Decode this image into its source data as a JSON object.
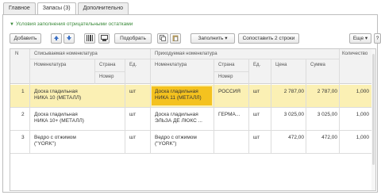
{
  "tabs": [
    {
      "label": "Главное"
    },
    {
      "label": "Запасы (3)"
    },
    {
      "label": "Дополнительно"
    }
  ],
  "condition_text": "Условия заполнения отрицательными остатками",
  "toolbar": {
    "add": "Добавить",
    "pick": "Подобрать",
    "fill": "Заполнить",
    "match": "Сопоставить 2 строки",
    "more": "Еще",
    "help": "?"
  },
  "table": {
    "group_written_off": "Списываемая номенклатура",
    "group_incoming": "Приходуемая номенклатура",
    "headers": {
      "n": "N",
      "nom1": "Номенклатура",
      "country1": "Страна",
      "number1": "Номер",
      "unit1": "Ед.",
      "nom2": "Номенклатура",
      "country2": "Страна",
      "number2": "Номер",
      "unit2": "Ед.",
      "price": "Цена",
      "sum": "Сумма",
      "qty": "Количество"
    },
    "rows": [
      {
        "n": "1",
        "nom1a": "Доска гладильная",
        "nom1b": "НИКА 10 (МЕТАЛЛ)",
        "unit1": "шт",
        "nom2a": "Доска гладильная",
        "nom2b": "НИКА 11 (МЕТАЛЛ)",
        "country2": "РОССИЯ",
        "unit2": "шт",
        "price": "2 787,00",
        "sum": "2 787,00",
        "qty": "1,000"
      },
      {
        "n": "2",
        "nom1a": "Доска гладильная",
        "nom1b": "НИКА 10+ (МЕТАЛЛ)",
        "unit1": "шт",
        "nom2a": "Доска гладильная",
        "nom2b": "ЭЛЬЗА ДЕ ЛЮКС ...",
        "country2": "ГЕРМА...",
        "unit2": "шт",
        "price": "3 025,00",
        "sum": "3 025,00",
        "qty": "1,000"
      },
      {
        "n": "3",
        "nom1a": "Ведро с отжимом",
        "nom1b": "(\"YORK\")",
        "unit1": "шт",
        "nom2a": "Ведро с отжимом",
        "nom2b": "(\"YORK\")",
        "country2": "",
        "unit2": "шт",
        "price": "472,00",
        "sum": "472,00",
        "qty": "1,000"
      }
    ]
  },
  "colors": {
    "selected_row": "#fbf0b4",
    "highlight_cell": "#f4c21f",
    "condition_link": "#3a8a3a"
  }
}
